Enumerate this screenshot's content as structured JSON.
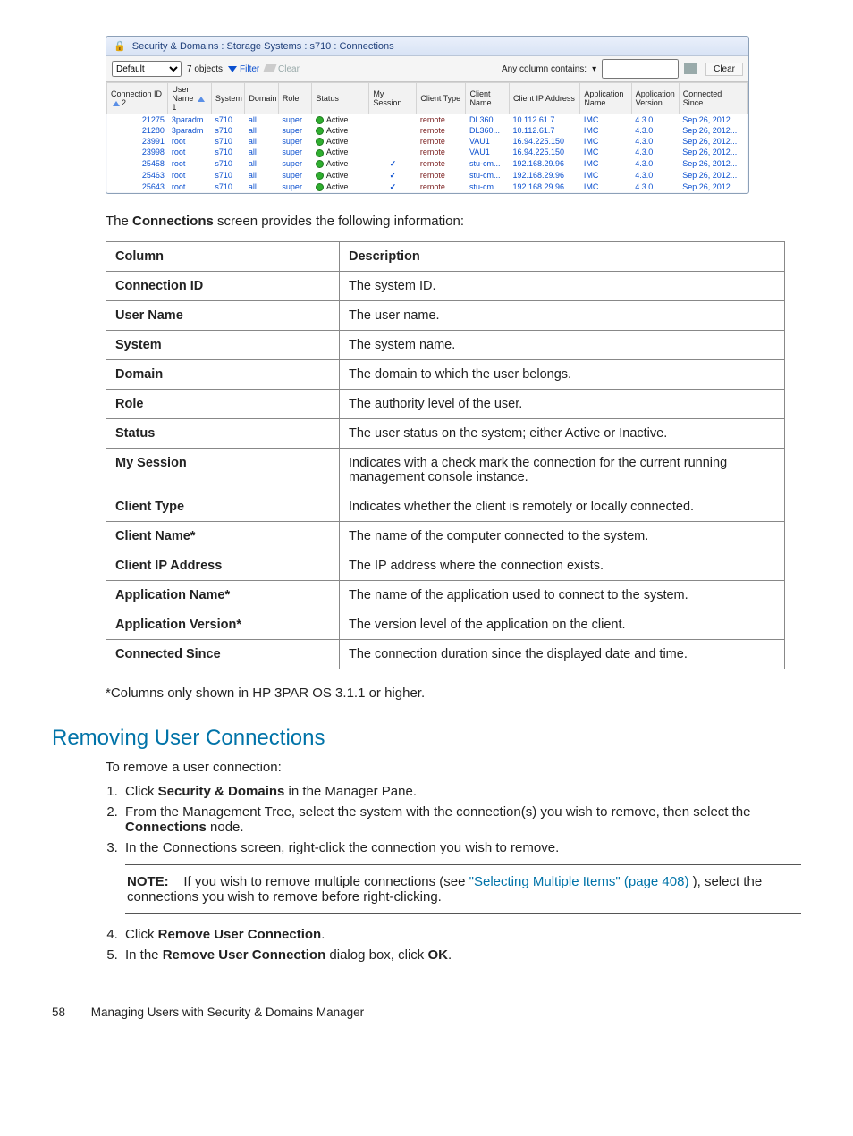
{
  "screenshot": {
    "breadcrumb": "Security & Domains : Storage Systems : s710 : Connections",
    "toolbar": {
      "selector_value": "Default",
      "objects": "7 objects",
      "filter": "Filter",
      "clear_link": "Clear",
      "contains_label": "Any column contains:",
      "search_value": "",
      "clear_btn": "Clear"
    },
    "columns": {
      "conn_id": "Connection ID",
      "sort2": "2",
      "user": "User Name",
      "sort1": "1",
      "system": "System",
      "domain": "Domain",
      "role": "Role",
      "status": "Status",
      "mysession": "My Session",
      "ctype": "Client Type",
      "cname": "Client Name",
      "cip": "Client IP Address",
      "appn": "Application Name",
      "appv": "Application Version",
      "csince": "Connected Since"
    },
    "rows": [
      {
        "id": "21275",
        "user": "3paradm",
        "sys": "s710",
        "dom": "all",
        "role": "super",
        "status": "Active",
        "my": "",
        "ctype": "remote",
        "cname": "DL360...",
        "cip": "10.112.61.7",
        "an": "IMC",
        "av": "4.3.0",
        "cs": "Sep 26, 2012..."
      },
      {
        "id": "21280",
        "user": "3paradm",
        "sys": "s710",
        "dom": "all",
        "role": "super",
        "status": "Active",
        "my": "",
        "ctype": "remote",
        "cname": "DL360...",
        "cip": "10.112.61.7",
        "an": "IMC",
        "av": "4.3.0",
        "cs": "Sep 26, 2012..."
      },
      {
        "id": "23991",
        "user": "root",
        "sys": "s710",
        "dom": "all",
        "role": "super",
        "status": "Active",
        "my": "",
        "ctype": "remote",
        "cname": "VAU1",
        "cip": "16.94.225.150",
        "an": "IMC",
        "av": "4.3.0",
        "cs": "Sep 26, 2012..."
      },
      {
        "id": "23998",
        "user": "root",
        "sys": "s710",
        "dom": "all",
        "role": "super",
        "status": "Active",
        "my": "",
        "ctype": "remote",
        "cname": "VAU1",
        "cip": "16.94.225.150",
        "an": "IMC",
        "av": "4.3.0",
        "cs": "Sep 26, 2012..."
      },
      {
        "id": "25458",
        "user": "root",
        "sys": "s710",
        "dom": "all",
        "role": "super",
        "status": "Active",
        "my": "✓",
        "ctype": "remote",
        "cname": "stu-cm...",
        "cip": "192.168.29.96",
        "an": "IMC",
        "av": "4.3.0",
        "cs": "Sep 26, 2012..."
      },
      {
        "id": "25463",
        "user": "root",
        "sys": "s710",
        "dom": "all",
        "role": "super",
        "status": "Active",
        "my": "✓",
        "ctype": "remote",
        "cname": "stu-cm...",
        "cip": "192.168.29.96",
        "an": "IMC",
        "av": "4.3.0",
        "cs": "Sep 26, 2012..."
      },
      {
        "id": "25643",
        "user": "root",
        "sys": "s710",
        "dom": "all",
        "role": "super",
        "status": "Active",
        "my": "✓",
        "ctype": "remote",
        "cname": "stu-cm...",
        "cip": "192.168.29.96",
        "an": "IMC",
        "av": "4.3.0",
        "cs": "Sep 26, 2012..."
      }
    ]
  },
  "intro": {
    "pre": "The ",
    "bold": "Connections",
    "post": " screen provides the following information:"
  },
  "doc_table": {
    "head_col": "Column",
    "head_desc": "Description",
    "rows": [
      {
        "c": "Connection ID",
        "d": "The system ID."
      },
      {
        "c": "User Name",
        "d": "The user name."
      },
      {
        "c": "System",
        "d": "The system name."
      },
      {
        "c": "Domain",
        "d": "The domain to which the user belongs."
      },
      {
        "c": "Role",
        "d": "The authority level of the user."
      },
      {
        "c": "Status",
        "d": "The user status on the system; either Active or Inactive."
      },
      {
        "c": "My Session",
        "d": "Indicates with a check mark the connection for the current running management console instance."
      },
      {
        "c": "Client Type",
        "d": "Indicates whether the client is remotely or locally connected."
      },
      {
        "c": "Client Name*",
        "d": "The name of the computer connected to the system."
      },
      {
        "c": "Client IP Address",
        "d": "The IP address where the connection exists."
      },
      {
        "c": "Application Name*",
        "d": "The name of the application used to connect to the system."
      },
      {
        "c": "Application Version*",
        "d": "The version level of the application on the client."
      },
      {
        "c": "Connected Since",
        "d": "The connection duration since the displayed date and time."
      }
    ]
  },
  "after_table_note": "*Columns only shown in HP 3PAR OS 3.1.1 or higher.",
  "section_heading": "Removing User Connections",
  "steps_intro": "To remove a user connection:",
  "steps": {
    "s1_pre": "Click ",
    "s1_b": "Security & Domains",
    "s1_post": " in the Manager Pane.",
    "s2_pre": "From the Management Tree, select the system with the connection(s) you wish to remove, then select the ",
    "s2_b": "Connections",
    "s2_post": " node.",
    "s3": "In the Connections screen, right-click the connection you wish to remove.",
    "note_label": "NOTE:",
    "note_pre": "If you wish to remove multiple connections (see ",
    "note_link": "\"Selecting Multiple Items\" (page 408)",
    "note_post": " ), select the connections you wish to remove before right-clicking.",
    "s4_pre": "Click ",
    "s4_b": "Remove User Connection",
    "s4_post": ".",
    "s5_pre": "In the ",
    "s5_b1": "Remove User Connection",
    "s5_mid": " dialog box, click ",
    "s5_b2": "OK",
    "s5_post": "."
  },
  "footer": {
    "page": "58",
    "title": "Managing Users with Security & Domains Manager"
  }
}
